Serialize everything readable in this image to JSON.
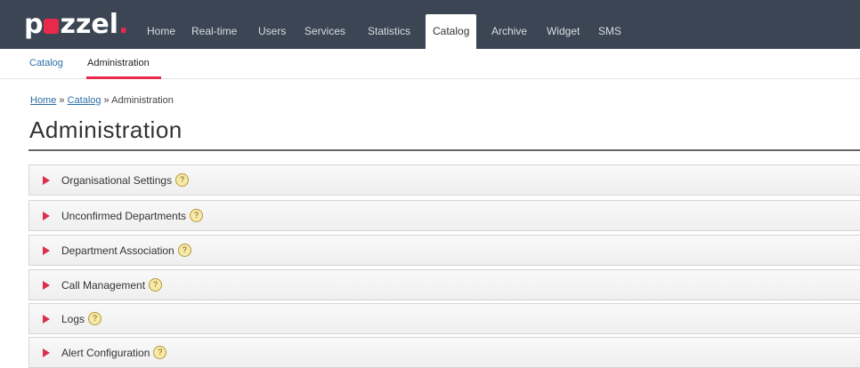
{
  "logo": {
    "text_p": "p",
    "text_rest": "zzel",
    "dot": "."
  },
  "nav": {
    "items": [
      {
        "label": "Home"
      },
      {
        "label": "Real-time"
      },
      {
        "label": "Users"
      },
      {
        "label": "Services"
      },
      {
        "label": "Statistics"
      },
      {
        "label": "Catalog",
        "active": true
      },
      {
        "label": "Archive"
      },
      {
        "label": "Widget"
      },
      {
        "label": "SMS"
      }
    ]
  },
  "subnav": {
    "items": [
      {
        "label": "Catalog"
      },
      {
        "label": "Administration",
        "active": true
      }
    ]
  },
  "breadcrumb": {
    "home": "Home",
    "sep1": " » ",
    "catalog": "Catalog",
    "sep2": " » ",
    "current": "Administration"
  },
  "page": {
    "title": "Administration"
  },
  "panels": [
    {
      "label": "Organisational Settings"
    },
    {
      "label": "Unconfirmed Departments"
    },
    {
      "label": "Department Association"
    },
    {
      "label": "Call Management"
    },
    {
      "label": "Logs"
    },
    {
      "label": "Alert Configuration"
    }
  ],
  "help_glyph": "?",
  "colors": {
    "topbar": "#3b4553",
    "accent": "#e8294c",
    "link": "#2e6ea8"
  }
}
